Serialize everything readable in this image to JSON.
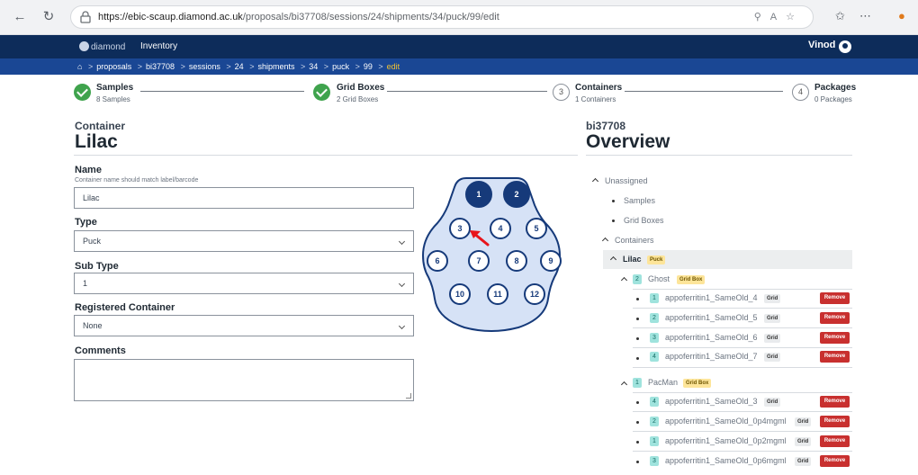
{
  "browser": {
    "url_host": "https://ebic-scaup.diamond.ac.uk",
    "url_path": "/proposals/bi37708/sessions/24/shipments/34/puck/99/edit"
  },
  "header": {
    "brand": "diamond",
    "nav_label": "Inventory",
    "user": "Vinod"
  },
  "breadcrumbs": [
    "proposals",
    "bi37708",
    "sessions",
    "24",
    "shipments",
    "34",
    "puck",
    "99",
    "edit"
  ],
  "stepper": [
    {
      "title": "Samples",
      "sub": "8 Samples",
      "state": "done"
    },
    {
      "title": "Grid Boxes",
      "sub": "2 Grid Boxes",
      "state": "done"
    },
    {
      "title": "Containers",
      "sub": "1 Containers",
      "state": "current",
      "number": "3"
    },
    {
      "title": "Packages",
      "sub": "0 Packages",
      "state": "pending",
      "number": "4"
    }
  ],
  "form": {
    "heading_small": "Container",
    "heading_large": "Lilac",
    "name_label": "Name",
    "name_help": "Container name should match label/barcode",
    "name_value": "Lilac",
    "type_label": "Type",
    "type_value": "Puck",
    "subtype_label": "Sub Type",
    "subtype_value": "1",
    "registered_label": "Registered Container",
    "registered_value": "None",
    "comments_label": "Comments"
  },
  "puck": {
    "positions": [
      "1",
      "2",
      "3",
      "4",
      "5",
      "6",
      "7",
      "8",
      "9",
      "10",
      "11",
      "12"
    ],
    "filled": [
      "1",
      "2"
    ],
    "fill_color": "#163a7a",
    "body_color": "#d6e2f6"
  },
  "overview": {
    "code": "bi37708",
    "title": "Overview",
    "unassigned": "Unassigned",
    "samples": "Samples",
    "grid_boxes": "Grid Boxes",
    "containers": "Containers",
    "container_name": "Lilac",
    "container_type": "Puck",
    "boxes": [
      {
        "index": "2",
        "name": "Ghost",
        "type": "Grid Box",
        "items": [
          {
            "index": "1",
            "name": "appoferritin1_SameOld_4",
            "tag": "Grid",
            "action": "Remove"
          },
          {
            "index": "2",
            "name": "appoferritin1_SameOld_5",
            "tag": "Grid",
            "action": "Remove"
          },
          {
            "index": "3",
            "name": "appoferritin1_SameOld_6",
            "tag": "Grid",
            "action": "Remove"
          },
          {
            "index": "4",
            "name": "appoferritin1_SameOld_7",
            "tag": "Grid",
            "action": "Remove"
          }
        ]
      },
      {
        "index": "1",
        "name": "PacMan",
        "type": "Grid Box",
        "items": [
          {
            "index": "4",
            "name": "appoferritin1_SameOld_3",
            "tag": "Grid",
            "action": "Remove"
          },
          {
            "index": "2",
            "name": "appoferritin1_SameOld_0p4mgml",
            "tag": "Grid",
            "action": "Remove"
          },
          {
            "index": "1",
            "name": "appoferritin1_SameOld_0p2mgml",
            "tag": "Grid",
            "action": "Remove"
          },
          {
            "index": "3",
            "name": "appoferritin1_SameOld_0p6mgml",
            "tag": "Grid",
            "action": "Remove"
          }
        ]
      }
    ]
  },
  "colors": {
    "header": "#0d2c5a",
    "breadcrumb": "#1a4794",
    "success": "#3fa34d",
    "remove": "#c8302f",
    "annotation_arrow": "#e8141b"
  }
}
